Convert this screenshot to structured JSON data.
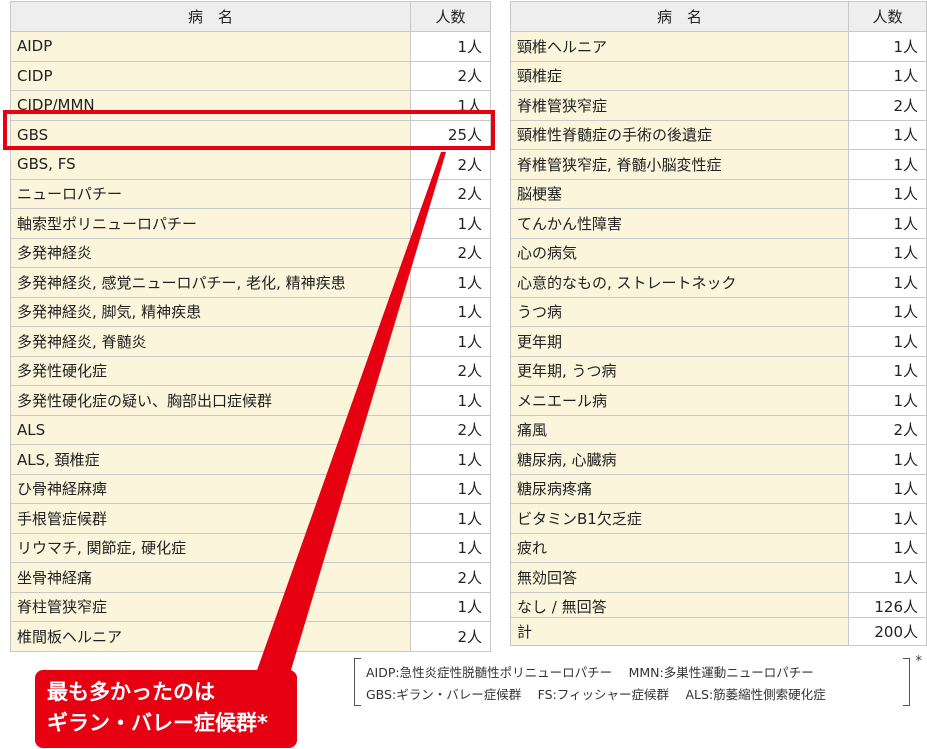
{
  "headers": {
    "name": "病　名",
    "count": "人数"
  },
  "left_rows": [
    {
      "name": "AIDP",
      "count": "1人"
    },
    {
      "name": "CIDP",
      "count": "2人"
    },
    {
      "name": "CIDP/MMN",
      "count": "1人"
    },
    {
      "name": "GBS",
      "count": "25人"
    },
    {
      "name": "GBS, FS",
      "count": "2人"
    },
    {
      "name": "ニューロパチー",
      "count": "2人"
    },
    {
      "name": "軸索型ポリニューロパチー",
      "count": "1人"
    },
    {
      "name": "多発神経炎",
      "count": "2人"
    },
    {
      "name": "多発神経炎, 感覚ニューロパチー, 老化, 精神疾患",
      "count": "1人"
    },
    {
      "name": "多発神経炎, 脚気, 精神疾患",
      "count": "1人"
    },
    {
      "name": "多発神経炎, 脊髄炎",
      "count": "1人"
    },
    {
      "name": "多発性硬化症",
      "count": "2人"
    },
    {
      "name": "多発性硬化症の疑い、胸部出口症候群",
      "count": "1人"
    },
    {
      "name": "ALS",
      "count": "2人"
    },
    {
      "name": "ALS, 頚椎症",
      "count": "1人"
    },
    {
      "name": "ひ骨神経麻痺",
      "count": "1人"
    },
    {
      "name": "手根管症候群",
      "count": "1人"
    },
    {
      "name": "リウマチ, 関節症, 硬化症",
      "count": "1人"
    },
    {
      "name": "坐骨神経痛",
      "count": "2人"
    },
    {
      "name": "脊柱管狭窄症",
      "count": "1人"
    },
    {
      "name": "椎間板ヘルニア",
      "count": "2人"
    }
  ],
  "right_rows": [
    {
      "name": "頸椎ヘルニア",
      "count": "1人"
    },
    {
      "name": "頸椎症",
      "count": "1人"
    },
    {
      "name": "脊椎管狭窄症",
      "count": "2人"
    },
    {
      "name": "頸椎性脊髄症の手術の後遺症",
      "count": "1人"
    },
    {
      "name": "脊椎管狭窄症, 脊髄小脳変性症",
      "count": "1人"
    },
    {
      "name": "脳梗塞",
      "count": "1人"
    },
    {
      "name": "てんかん性障害",
      "count": "1人"
    },
    {
      "name": "心の病気",
      "count": "1人"
    },
    {
      "name": "心意的なもの, ストレートネック",
      "count": "1人"
    },
    {
      "name": "うつ病",
      "count": "1人"
    },
    {
      "name": "更年期",
      "count": "1人"
    },
    {
      "name": "更年期, うつ病",
      "count": "1人"
    },
    {
      "name": "メニエール病",
      "count": "1人"
    },
    {
      "name": "痛風",
      "count": "2人"
    },
    {
      "name": "糖尿病, 心臓病",
      "count": "1人"
    },
    {
      "name": "糖尿病疼痛",
      "count": "1人"
    },
    {
      "name": "ビタミンB1欠乏症",
      "count": "1人"
    },
    {
      "name": "疲れ",
      "count": "1人"
    },
    {
      "name": "無効回答",
      "count": "1人"
    },
    {
      "name": "なし / 無回答",
      "count": "126人"
    }
  ],
  "total": {
    "label": "計",
    "count": "200人"
  },
  "callout": {
    "line1": "最も多かったのは",
    "line2": "ギラン・バレー症候群*"
  },
  "legend": {
    "line1": "AIDP:急性炎症性脱髄性ポリニューロパチー　 MMN:多巣性運動ニューロパチー",
    "line2": "GBS:ギラン・バレー症候群　 FS:フィッシャー症候群　 ALS:筋萎縮性側索硬化症",
    "star": "*"
  },
  "colors": {
    "accent_red": "#e60012",
    "name_cell_bg": "#fbf5dc",
    "header_bg": "#eeeeee"
  }
}
